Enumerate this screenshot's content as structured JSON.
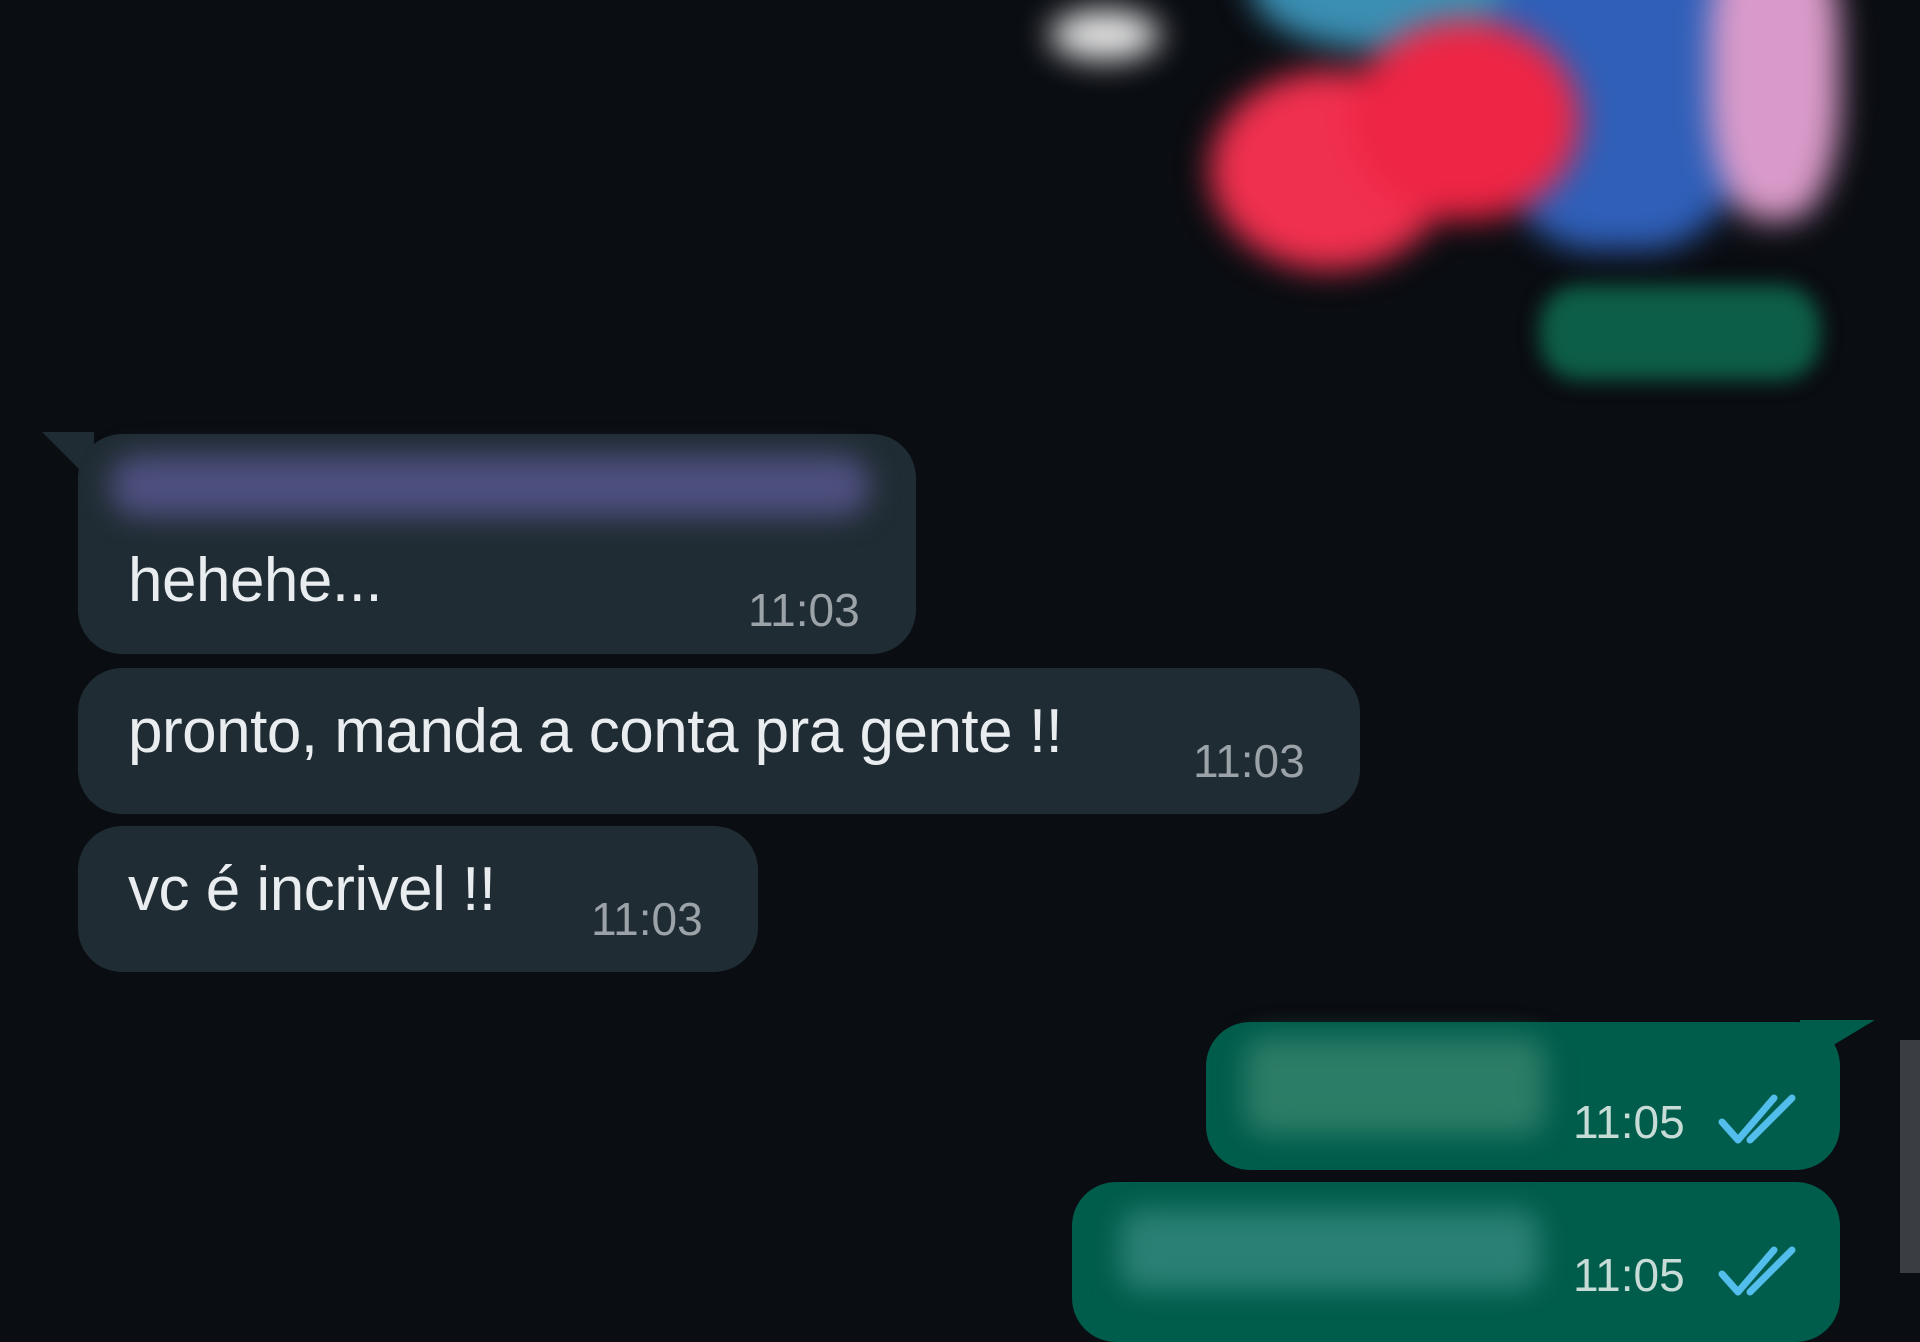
{
  "messages": [
    {
      "direction": "in",
      "text": "hehehe...",
      "time": "11:03"
    },
    {
      "direction": "in",
      "text": "pronto, manda a conta pra gente !!",
      "time": "11:03"
    },
    {
      "direction": "in",
      "text": "vc é incrivel !!",
      "time": "11:03"
    },
    {
      "direction": "out",
      "time": "11:05",
      "status": "read"
    },
    {
      "direction": "out",
      "time": "11:05",
      "status": "read"
    }
  ],
  "colors": {
    "background": "#0a0d12",
    "incoming_bubble": "#202c33",
    "outgoing_bubble": "#005c4b",
    "read_ticks": "#53bdeb"
  },
  "icons": {
    "read_receipt": "double-check-icon"
  }
}
